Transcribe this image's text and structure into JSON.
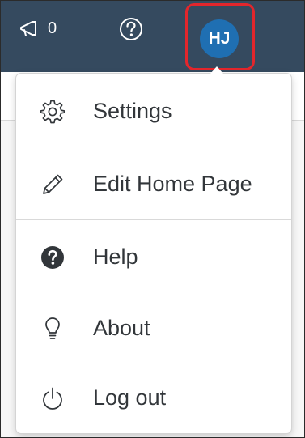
{
  "shell": {
    "notifications_count": "0",
    "user_initials": "HJ"
  },
  "colors": {
    "shell_bar": "#354a5f",
    "avatar_bg": "#1f6fb2",
    "highlight": "#e3262c",
    "menu_text": "#32363a"
  },
  "menu": {
    "items": [
      {
        "label": "Settings",
        "icon": "gear-icon"
      },
      {
        "label": "Edit Home Page",
        "icon": "pencil-icon"
      },
      {
        "label": "Help",
        "icon": "help-circle-icon"
      },
      {
        "label": "About",
        "icon": "lightbulb-icon"
      },
      {
        "label": "Log out",
        "icon": "power-icon"
      }
    ]
  }
}
